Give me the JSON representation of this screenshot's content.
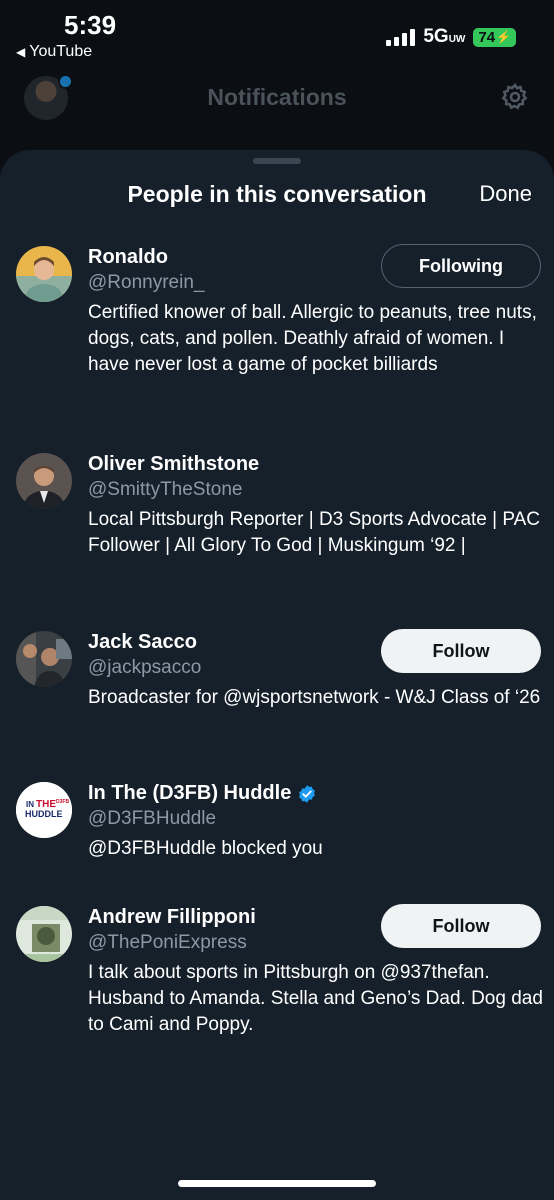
{
  "status_bar": {
    "time": "5:39",
    "back_app": "YouTube",
    "network": "5G",
    "network_sub": "UW",
    "battery": "74",
    "battery_color": "#34c759"
  },
  "background": {
    "title": "Notifications",
    "settings_icon": "gear-icon"
  },
  "sheet": {
    "title": "People in this conversation",
    "done_label": "Done"
  },
  "users": [
    {
      "name": "Ronaldo",
      "handle": "@Ronnyrein_",
      "bio": "Certified knower of ball. Allergic to peanuts, tree nuts, dogs, cats, and pollen. Deathly afraid of women. I have never lost a game of pocket billiards",
      "button": "Following",
      "verified": false
    },
    {
      "name": "Oliver Smithstone",
      "handle": "@SmittyTheStone",
      "bio": "Local Pittsburgh Reporter | D3 Sports Advocate | PAC Follower | All Glory To God | Muskingum ‘92 |",
      "button": null,
      "verified": false
    },
    {
      "name": "Jack Sacco",
      "handle": "@jackpsacco",
      "bio": "Broadcaster for @wjsportsnetwork - W&J Class of ‘26",
      "button": "Follow",
      "verified": false
    },
    {
      "name": "In The (D3FB) Huddle",
      "handle": "@D3FBHuddle",
      "bio": "@D3FBHuddle blocked you",
      "button": null,
      "verified": true,
      "avatar_text": [
        "IN",
        "THE",
        "D3FB",
        "HUDDLE"
      ]
    },
    {
      "name": "Andrew Fillipponi",
      "handle": "@ThePoniExpress",
      "bio": "I talk about sports in Pittsburgh on @937thefan. Husband to Amanda. Stella and Geno’s Dad. Dog dad to Cami and Poppy.",
      "button": "Follow",
      "verified": false
    }
  ],
  "colors": {
    "sheet_bg": "#15202b",
    "handle": "#8b98a5",
    "verified": "#1d9bf0"
  }
}
